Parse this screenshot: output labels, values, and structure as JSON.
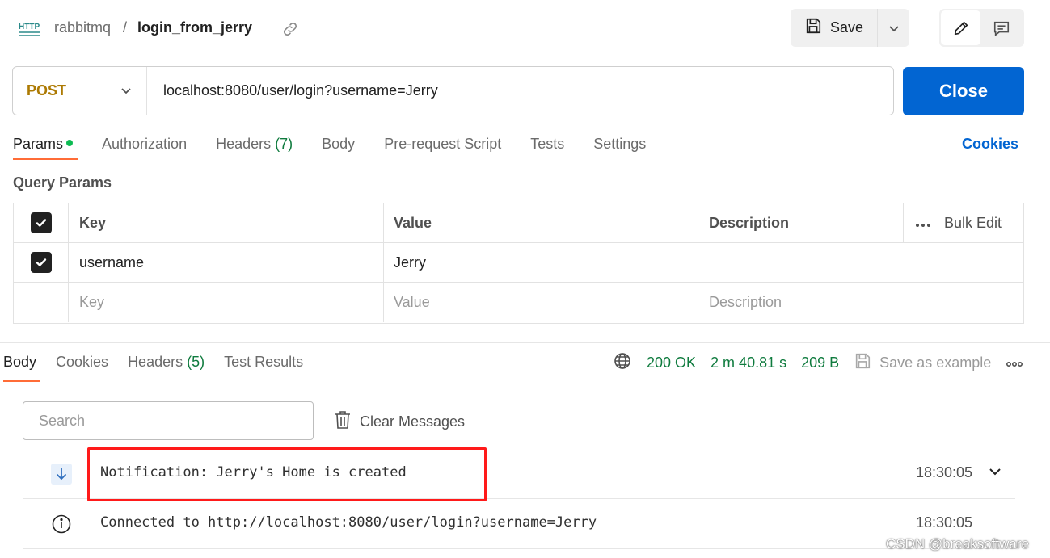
{
  "header": {
    "icon": "http-icon",
    "icon_text": "HTTP",
    "breadcrumb_parent": "rabbitmq",
    "breadcrumb_sep": "/",
    "request_name": "login_from_jerry",
    "save_label": "Save"
  },
  "request": {
    "method": "POST",
    "url": "localhost:8080/user/login?username=Jerry",
    "action_label": "Close"
  },
  "tabs": {
    "params": "Params",
    "authorization": "Authorization",
    "headers": "Headers",
    "headers_count": "(7)",
    "body": "Body",
    "prerequest": "Pre-request Script",
    "tests": "Tests",
    "settings": "Settings",
    "cookies": "Cookies"
  },
  "query_params": {
    "title": "Query Params",
    "columns": {
      "key": "Key",
      "value": "Value",
      "description": "Description"
    },
    "bulk_edit": "Bulk Edit",
    "rows": [
      {
        "checked": true,
        "key": "username",
        "value": "Jerry",
        "description": ""
      }
    ],
    "placeholders": {
      "key": "Key",
      "value": "Value",
      "description": "Description"
    }
  },
  "response": {
    "tabs": {
      "body": "Body",
      "cookies": "Cookies",
      "headers": "Headers",
      "headers_count": "(5)",
      "test_results": "Test Results"
    },
    "status": "200 OK",
    "time": "2 m 40.81 s",
    "size": "209 B",
    "save_example": "Save as example",
    "search_placeholder": "Search",
    "clear_messages": "Clear Messages",
    "messages": [
      {
        "icon": "arrow-down-icon",
        "text": "Notification: Jerry's Home is created",
        "time": "18:30:05",
        "expandable": true
      },
      {
        "icon": "info-icon",
        "text": "Connected to http://localhost:8080/user/login?username=Jerry",
        "time": "18:30:05",
        "expandable": false
      }
    ]
  },
  "watermark": "CSDN @breaksoftware",
  "colors": {
    "primary": "#0265d2",
    "method": "#ad7a03",
    "success": "#0f7b3e",
    "active_tab": "#ff6c37",
    "annotation": "#ff1a1a"
  }
}
